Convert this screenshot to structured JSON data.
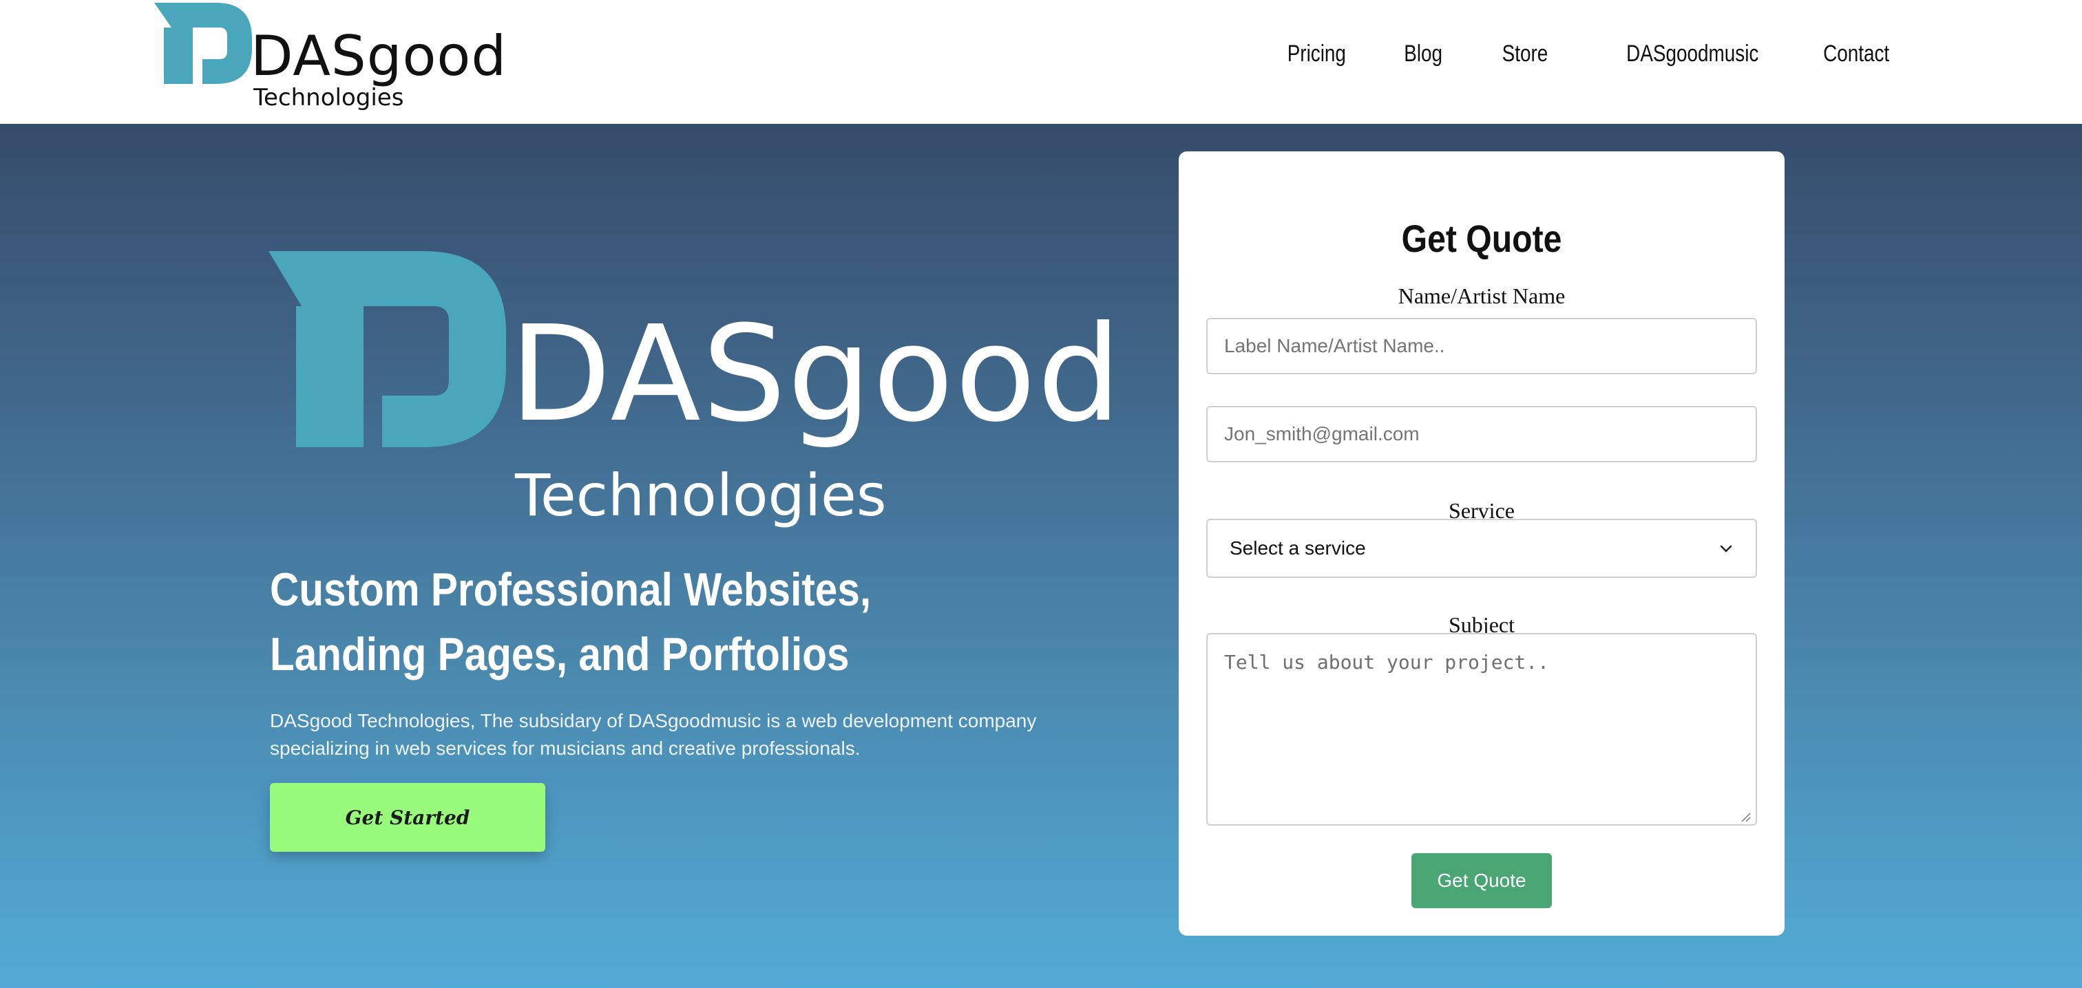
{
  "header": {
    "logo_brand": "DASgood",
    "logo_sub": "Technologies",
    "nav": [
      "Pricing",
      "Blog",
      "Store",
      "DASgoodmusic",
      "Contact"
    ]
  },
  "hero": {
    "logo_brand": "DASgood",
    "logo_sub": "Technologies",
    "headline": "Custom Professional Websites, Landing Pages, and Porftolios",
    "description": "DASgood Technologies, The subsidary of DASgoodmusic is a web development company specializing in web services for musicians and creative professionals.",
    "cta_label": "Get Started"
  },
  "form": {
    "title": "Get Quote",
    "name_label": "Name/Artist Name",
    "name_placeholder": "Label Name/Artist Name..",
    "email_placeholder": "Jon_smith@gmail.com",
    "service_label": "Service",
    "service_selected": "Select a service",
    "subject_label": "Subject",
    "subject_placeholder": "Tell us about your project..",
    "submit_label": "Get Quote"
  },
  "colors": {
    "brand_teal": "#4aa7bb",
    "cta_green": "#98fb7b",
    "submit_green": "#4aa574",
    "hero_top": "#364c6b",
    "hero_bottom": "#52abd6"
  },
  "icons": {
    "logo_mark": "das-logo-mark-icon",
    "select_chevron": "chevron-down-icon",
    "textarea_resize": "resize-grip-icon"
  }
}
